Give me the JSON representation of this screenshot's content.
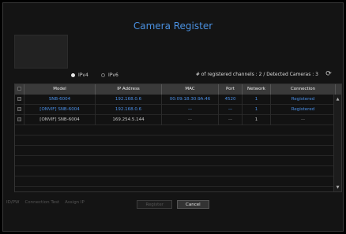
{
  "title": "Camera Register",
  "ip_options": [
    {
      "label": "IPv4",
      "selected": true
    },
    {
      "label": "IPv6",
      "selected": false
    }
  ],
  "registered_info": "# of registered channels : 2 / Detected Cameras : 3",
  "refresh_icon": "refresh-icon",
  "table": {
    "headers": [
      "Model",
      "IP Address",
      "MAC",
      "Port",
      "Network",
      "Connection"
    ],
    "rows": [
      {
        "model": "SNB-6004",
        "ip": "192.168.0.6",
        "mac": "00:09:18:30:9A:46",
        "port": "4520",
        "network": "1",
        "connection": "Registered",
        "style": "blue"
      },
      {
        "model": "[ONVIF] SNB-6004",
        "ip": "192.168.0.6",
        "mac": "—",
        "port": "—",
        "network": "1",
        "connection": "Registered",
        "style": "blue"
      },
      {
        "model": "[ONVIF] SNB-6004",
        "ip": "169.254.5.144",
        "mac": "—",
        "port": "—",
        "network": "1",
        "connection": "—",
        "style": "normal"
      }
    ]
  },
  "tools": [
    "ID/PW",
    "Connection Test",
    "Assign IP"
  ],
  "buttons": {
    "register": "Register",
    "cancel": "Cancel"
  },
  "colors": {
    "accent": "#4a90e0",
    "background": "#141414",
    "header": "#3a3a3a"
  }
}
